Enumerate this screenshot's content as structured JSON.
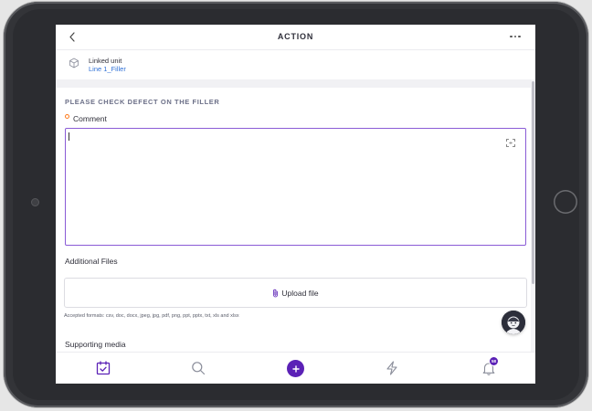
{
  "header": {
    "title": "ACTION"
  },
  "linked_unit": {
    "label": "Linked unit",
    "value": "Line 1_Filler"
  },
  "form": {
    "section_heading": "PLEASE CHECK DEFECT ON THE FILLER",
    "comment_label": "Comment",
    "comment_value": "",
    "additional_files_label": "Additional Files",
    "upload_label": "Upload file",
    "accepted_formats": "Accepted formats: csv, doc, docx, jpeg, jpg, pdf, png, ppt, pptx, txt, xls and xlsx",
    "supporting_media_label": "Supporting media"
  },
  "nav": {
    "items": [
      "tasks-icon",
      "search-icon",
      "add-icon",
      "lightning-icon",
      "bell-icon"
    ],
    "notification_count": "58"
  },
  "colors": {
    "accent": "#5b21b6",
    "link": "#2e6fd6",
    "required": "#ff7a1a",
    "focus_border": "#8a5bd6"
  }
}
